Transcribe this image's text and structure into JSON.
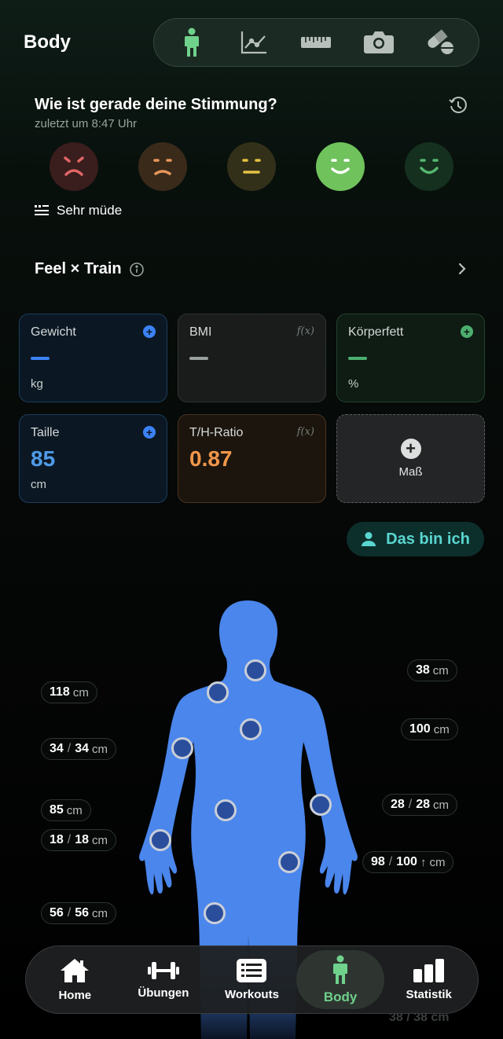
{
  "header": {
    "title": "Body",
    "nav": [
      {
        "icon": "body-icon",
        "active": true
      },
      {
        "icon": "chart-line-icon"
      },
      {
        "icon": "ruler-icon"
      },
      {
        "icon": "camera-icon"
      },
      {
        "icon": "pills-icon"
      }
    ]
  },
  "mood": {
    "question": "Wie ist gerade deine Stimmung?",
    "last_updated": "zuletzt um 8:47 Uhr",
    "faces": [
      {
        "name": "very-sad-face-icon",
        "color": "#e06666",
        "bg": "#3a1d1d"
      },
      {
        "name": "sad-face-icon",
        "color": "#e9975a",
        "bg": "#3a2a1a"
      },
      {
        "name": "neutral-face-icon",
        "color": "#e6c244",
        "bg": "#33301a"
      },
      {
        "name": "happy-face-icon",
        "color": "#ffffff",
        "bg": "#6fc25c",
        "selected": true
      },
      {
        "name": "very-happy-face-icon",
        "color": "#56b870",
        "bg": "#15301f"
      }
    ],
    "note": "Sehr müde"
  },
  "feel_train": {
    "label": "Feel × Train"
  },
  "cards": {
    "weight": {
      "label": "Gewicht",
      "value": "—",
      "unit": "kg",
      "accent": "#3b82f6"
    },
    "bmi": {
      "label": "BMI",
      "value": "—",
      "badge": "f(x)"
    },
    "bodyfat": {
      "label": "Körperfett",
      "value": "—",
      "unit": "%",
      "accent": "#4caf6e"
    },
    "waist": {
      "label": "Taille",
      "value": "85",
      "unit": "cm",
      "accent": "#4f9be8"
    },
    "whr": {
      "label": "T/H-Ratio",
      "value": "0.87",
      "badge": "f(x)",
      "accent": "#f0974a"
    },
    "add": {
      "label": "Maß"
    }
  },
  "me_button": {
    "label": "Das bin ich"
  },
  "measurements": {
    "left": [
      {
        "value": "118",
        "unit": "cm"
      },
      {
        "value": "34",
        "value2": "34",
        "unit": "cm"
      },
      {
        "value": "85",
        "unit": "cm"
      },
      {
        "value": "18",
        "value2": "18",
        "unit": "cm"
      },
      {
        "value": "56",
        "value2": "56",
        "unit": "cm"
      }
    ],
    "right": [
      {
        "value": "38",
        "unit": "cm"
      },
      {
        "value": "100",
        "unit": "cm"
      },
      {
        "value": "28",
        "value2": "28",
        "unit": "cm"
      },
      {
        "value": "98",
        "value2": "100",
        "arrow": "↑",
        "unit": "cm"
      }
    ],
    "ghost": "38 / 38 cm"
  },
  "bottom_nav": [
    {
      "label": "Home",
      "icon": "home-icon"
    },
    {
      "label": "Übungen",
      "icon": "dumbbell-icon"
    },
    {
      "label": "Workouts",
      "icon": "list-icon"
    },
    {
      "label": "Body",
      "icon": "body-icon",
      "active": true
    },
    {
      "label": "Statistik",
      "icon": "bar-chart-icon"
    }
  ]
}
